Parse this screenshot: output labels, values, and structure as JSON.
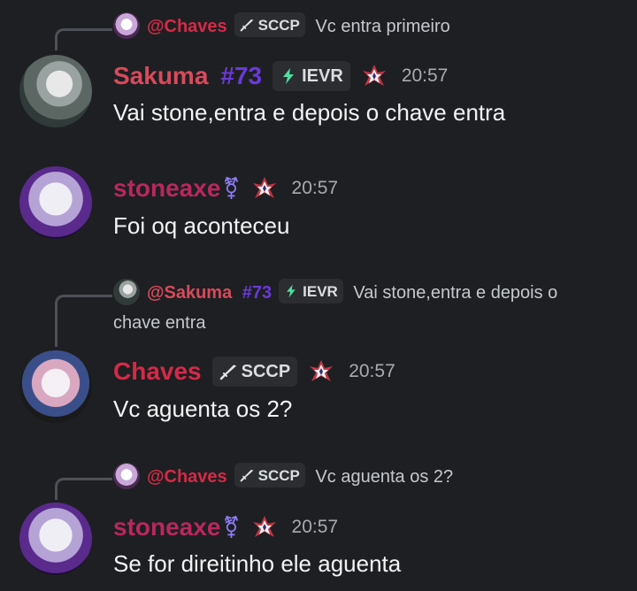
{
  "colors": {
    "sakuma": "#d84a5c",
    "stoneaxe": "#b8285c",
    "chaves": "#d42a48",
    "number": "#6a3ad8",
    "tag_bg": "#2b2d31",
    "timestamp": "#a8abb1"
  },
  "messages": [
    {
      "reply": {
        "author": "@Chaves",
        "tag": "SCCP",
        "text": "Vc entra primeiro"
      },
      "author": "Sakuma",
      "number": "#73",
      "tag": "IEVR",
      "time": "20:57",
      "text": "Vai stone,entra e depois o chave entra"
    },
    {
      "author": "stoneaxe",
      "symbol": "⚧",
      "time": "20:57",
      "text": "Foi oq aconteceu"
    },
    {
      "reply": {
        "author": "@Sakuma",
        "number": "#73",
        "tag": "IEVR",
        "text": "Vai stone,entra e depois o",
        "text_cont": "chave entra"
      },
      "author": "Chaves",
      "tag": "SCCP",
      "time": "20:57",
      "text": "Vc aguenta os 2?"
    },
    {
      "reply": {
        "author": "@Chaves",
        "tag": "SCCP",
        "text": "Vc aguenta os 2?"
      },
      "author": "stoneaxe",
      "symbol": "⚧",
      "time": "20:57",
      "text": "Se for direitinho ele aguenta"
    }
  ]
}
